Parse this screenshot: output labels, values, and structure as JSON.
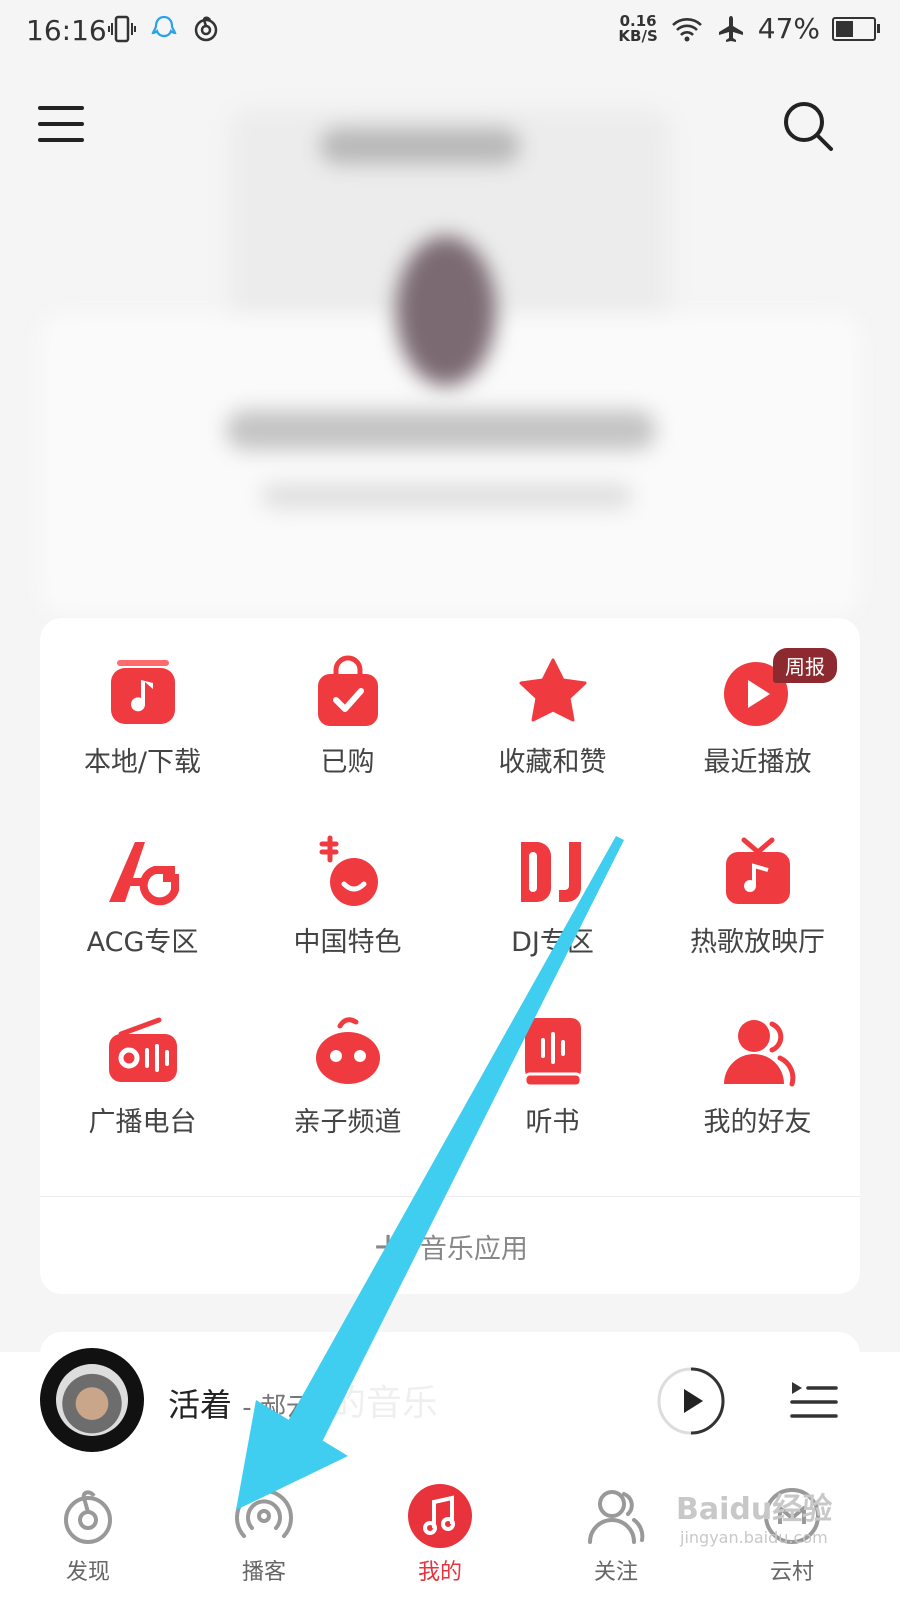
{
  "status_bar": {
    "time": "16:16",
    "speed_value": "0.16",
    "speed_unit": "KB/S",
    "battery": "47%",
    "battery_level": 0.47
  },
  "apps": [
    {
      "label": "本地/下载",
      "icon": "local-download-icon"
    },
    {
      "label": "已购",
      "icon": "purchased-bag-icon"
    },
    {
      "label": "收藏和赞",
      "icon": "star-icon"
    },
    {
      "label": "最近播放",
      "icon": "recent-play-icon",
      "badge": "周报"
    },
    {
      "label": "ACG专区",
      "icon": "acg-icon"
    },
    {
      "label": "中国特色",
      "icon": "pipa-icon"
    },
    {
      "label": "DJ专区",
      "icon": "dj-icon"
    },
    {
      "label": "热歌放映厅",
      "icon": "tv-icon"
    },
    {
      "label": "广播电台",
      "icon": "radio-icon"
    },
    {
      "label": "亲子频道",
      "icon": "kid-face-icon"
    },
    {
      "label": "听书",
      "icon": "audiobook-icon"
    },
    {
      "label": "我的好友",
      "icon": "friends-icon"
    }
  ],
  "add_app": {
    "label": "音乐应用"
  },
  "player": {
    "title": "活着",
    "artist": "- 郝云",
    "ghost": "的音乐"
  },
  "tabs": [
    {
      "label": "发现",
      "icon": "discover-icon"
    },
    {
      "label": "播客",
      "icon": "podcast-icon"
    },
    {
      "label": "我的",
      "icon": "my-music-icon"
    },
    {
      "label": "关注",
      "icon": "follow-icon"
    },
    {
      "label": "云村",
      "icon": "cloud-village-icon"
    }
  ],
  "watermark": {
    "main": "Baidu经验",
    "sub": "jingyan.baidu.com"
  },
  "colors": {
    "accent": "#e8323c",
    "arrow": "#3fcdf0"
  }
}
